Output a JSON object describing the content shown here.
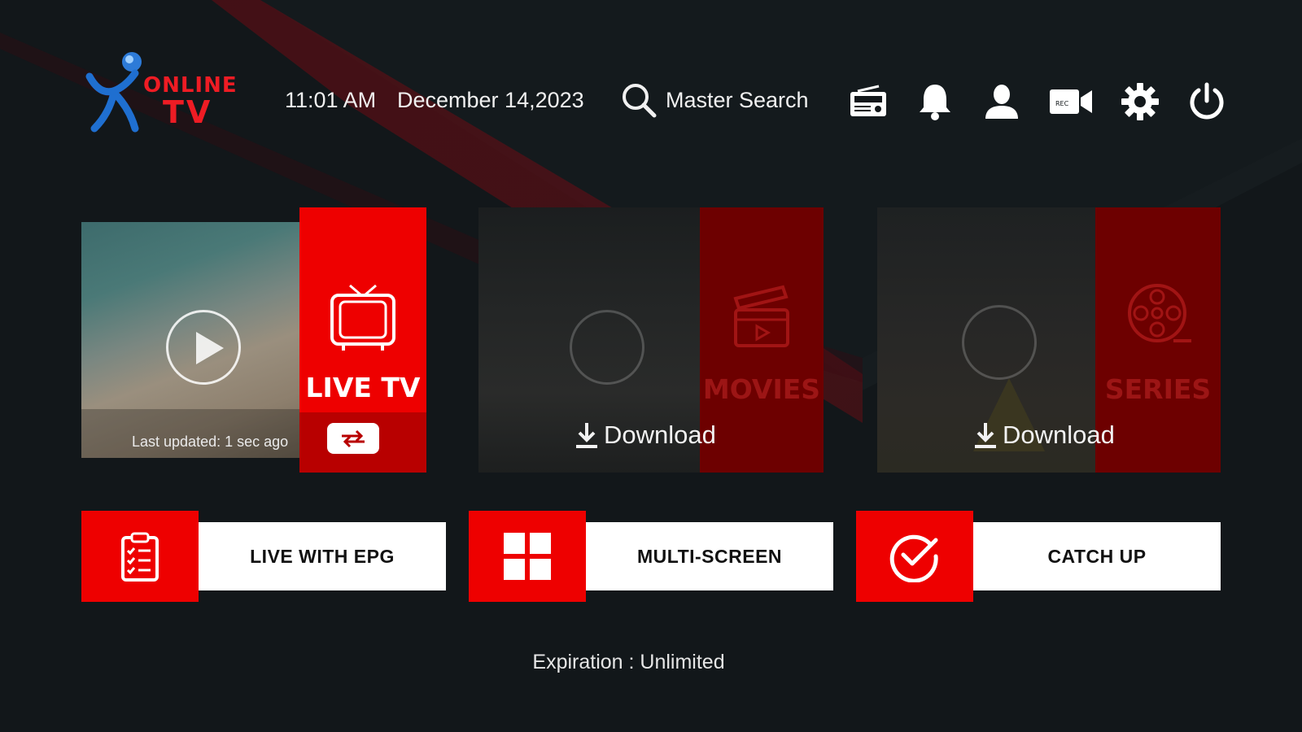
{
  "header": {
    "logo": {
      "word1": "ONLINE",
      "word2": "TV"
    },
    "time": "11:01 AM",
    "date": "December 14,2023",
    "search_label": "Master Search",
    "icons": [
      "radio-icon",
      "bell-icon",
      "user-icon",
      "video-camera-icon",
      "gear-icon",
      "power-icon"
    ]
  },
  "tiles": {
    "live": {
      "label": "LIVE TV",
      "last_updated": "Last updated: 1 sec ago"
    },
    "movies": {
      "label": "MOVIES",
      "download_label": "Download"
    },
    "series": {
      "label": "SERIES",
      "download_label": "Download"
    }
  },
  "buttons": {
    "epg": "LIVE WITH EPG",
    "multiscreen": "MULTI-SCREEN",
    "catchup": "CATCH UP"
  },
  "footer": {
    "expiration": "Expiration : Unlimited"
  },
  "colors": {
    "accent": "#ee0000",
    "background": "#12171a",
    "dark_red": "#7a0000"
  }
}
